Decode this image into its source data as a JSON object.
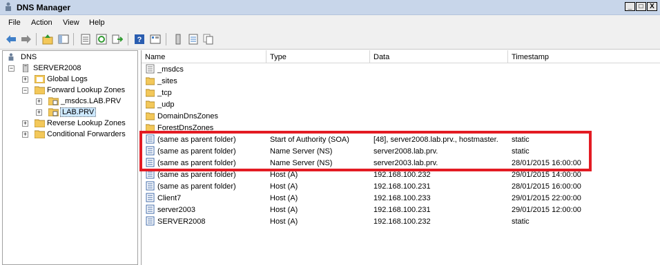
{
  "window": {
    "title": "DNS Manager",
    "buttons": [
      "_",
      "□",
      "X"
    ]
  },
  "menu": [
    "File",
    "Action",
    "View",
    "Help"
  ],
  "toolbar": [
    "back-icon",
    "forward-icon",
    "up-icon",
    "show-hide-tree-icon",
    "properties-icon",
    "refresh-icon",
    "export-icon",
    "help-icon",
    "view-icon",
    "server-icon",
    "list-icon",
    "copy-icon"
  ],
  "tree": {
    "root": "DNS",
    "server": "SERVER2008",
    "global_logs": "Global Logs",
    "forward_zones": "Forward Lookup Zones",
    "msdcs_zone": "_msdcs.LAB.PRV",
    "lab_zone": "LAB.PRV",
    "reverse_zones": "Reverse Lookup Zones",
    "conditional": "Conditional Forwarders"
  },
  "columns": [
    "Name",
    "Type",
    "Data",
    "Timestamp"
  ],
  "folders": [
    "_msdcs",
    "_sites",
    "_tcp",
    "_udp",
    "DomainDnsZones",
    "ForestDnsZones"
  ],
  "records": [
    {
      "name": "(same as parent folder)",
      "type": "Start of Authority (SOA)",
      "data": "[48], server2008.lab.prv., hostmaster.",
      "timestamp": "static"
    },
    {
      "name": "(same as parent folder)",
      "type": "Name Server (NS)",
      "data": "server2008.lab.prv.",
      "timestamp": "static"
    },
    {
      "name": "(same as parent folder)",
      "type": "Name Server (NS)",
      "data": "server2003.lab.prv.",
      "timestamp": "28/01/2015 16:00:00"
    },
    {
      "name": "(same as parent folder)",
      "type": "Host (A)",
      "data": "192.168.100.232",
      "timestamp": "29/01/2015 14:00:00"
    },
    {
      "name": "(same as parent folder)",
      "type": "Host (A)",
      "data": "192.168.100.231",
      "timestamp": "28/01/2015 16:00:00"
    },
    {
      "name": "Client7",
      "type": "Host (A)",
      "data": "192.168.100.233",
      "timestamp": "29/01/2015 22:00:00"
    },
    {
      "name": "server2003",
      "type": "Host (A)",
      "data": "192.168.100.231",
      "timestamp": "29/01/2015 12:00:00"
    },
    {
      "name": "SERVER2008",
      "type": "Host (A)",
      "data": "192.168.100.232",
      "timestamp": "static"
    }
  ],
  "colors": {
    "highlight": "#e31b23",
    "selected_bg": "#cce8ff",
    "folder": "#f3c85a"
  }
}
